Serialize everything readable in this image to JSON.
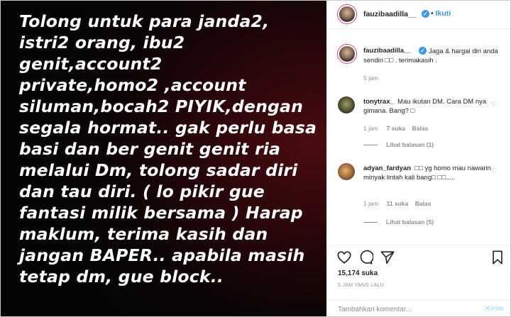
{
  "post": {
    "image_text": "Tolong untuk para janda2,\nistri2 orang, ibu2\ngenit,account2\nprivate,homo2 ,account\nsiluman,bocah2 PIYIK,dengan\nsegala hormat.. gak perlu basa\nbasi dan ber genit genit ria\nmelalui Dm, tolong sadar diri\ndan tau diri. ( lo pikir gue\nfantasi milik bersama ) Harap\nmaklum, terima kasih dan\njangan BAPER..  apabila masih\ntetap dm, gue block.."
  },
  "header": {
    "username": "fauzibaadilla__",
    "separator": "•",
    "follow_label": "Ikuti"
  },
  "caption": {
    "username": "fauzibaadilla__",
    "text": "Jaga & hargai diri anda sendiri □□ . terimakasih .",
    "time": "5 jam"
  },
  "comments": [
    {
      "username": "tonytrax_",
      "text": "Mau ikutan DM. Cara DM nya gimana. Bang? □",
      "time": "1 jam",
      "likes": "7 suka",
      "reply": "Balas",
      "view_replies": "Lihat balasan (1)"
    },
    {
      "username": "adyan_fardyan",
      "text": "□□ yg homo mau nawarin minyak lintah kali bang□ □□.....",
      "time": "1 jam",
      "likes": "11 suka",
      "reply": "Balas",
      "view_replies": "Lihat balasan (5)"
    }
  ],
  "actions": {
    "likes": "15,174 suka",
    "timestamp": "5 JAM YANG LALU"
  },
  "add_comment": {
    "placeholder": "Tambahkan komentar...",
    "post_label": "Kirim"
  },
  "colors": {
    "accent": "#3897f0",
    "muted": "#8e8e8e",
    "text": "#262626"
  },
  "icons": [
    "heart-icon",
    "comment-icon",
    "share-icon",
    "bookmark-icon",
    "verified-icon"
  ]
}
